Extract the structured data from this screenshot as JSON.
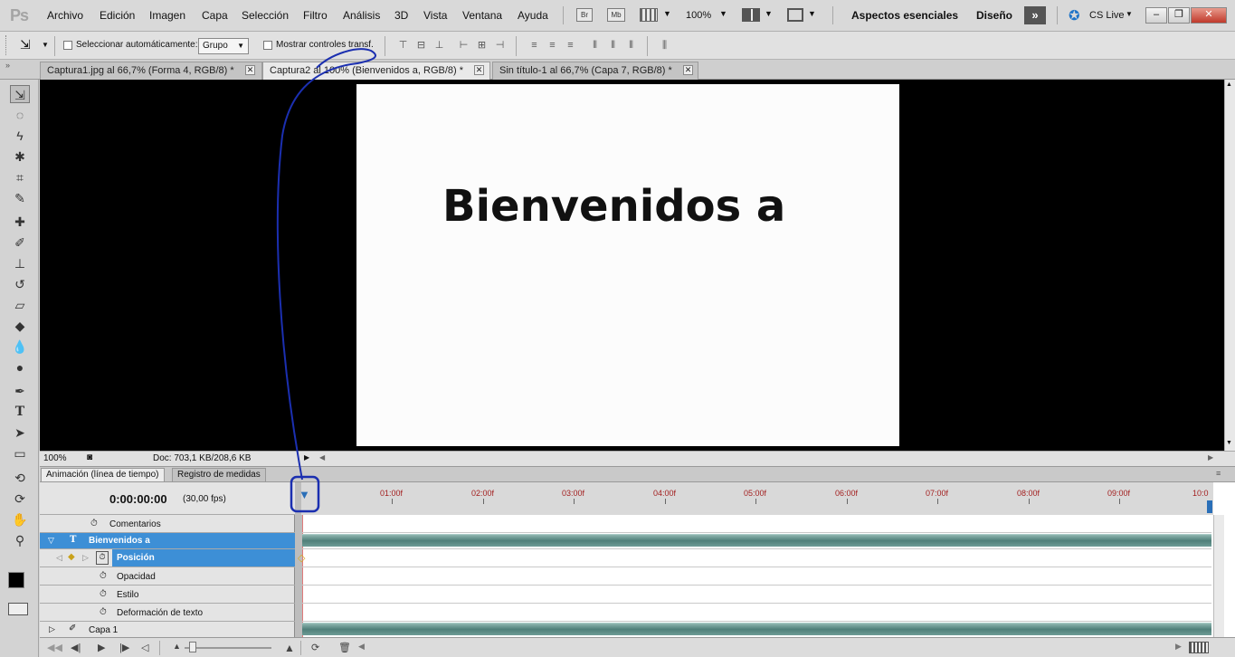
{
  "app": {
    "logo": "Ps"
  },
  "menu": [
    "Archivo",
    "Edición",
    "Imagen",
    "Capa",
    "Selección",
    "Filtro",
    "Análisis",
    "3D",
    "Vista",
    "Ventana",
    "Ayuda"
  ],
  "appbar": {
    "bridge": "Br",
    "minibridge": "Mb",
    "zoom": "100%",
    "workspace_essentials": "Aspectos esenciales",
    "workspace_design": "Diseño",
    "cslive": "CS Live"
  },
  "options": {
    "auto_select_label": "Seleccionar automáticamente:",
    "auto_select_value": "Grupo",
    "show_transform_label": "Mostrar controles transf."
  },
  "tabs": [
    {
      "label": "Captura1.jpg al 66,7% (Forma 4, RGB/8) *"
    },
    {
      "label": "Captura2 al 100% (Bienvenidos a, RGB/8) *"
    },
    {
      "label": "Sin título-1 al 66,7% (Capa 7, RGB/8) *"
    }
  ],
  "document": {
    "text": "Bienvenidos a"
  },
  "status": {
    "zoom": "100%",
    "doc": "Doc: 703,1 KB/208,6 KB"
  },
  "panel": {
    "tab_animation": "Animación (línea de tiempo)",
    "tab_measure": "Registro de medidas"
  },
  "timeline": {
    "timecode": "0:00:00:00",
    "fps": "(30,00 fps)",
    "ticks": [
      "01:00f",
      "02:00f",
      "03:00f",
      "04:00f",
      "05:00f",
      "06:00f",
      "07:00f",
      "08:00f",
      "09:00f",
      "10:0"
    ],
    "rows": {
      "comments": "Comentarios",
      "layer1": "Bienvenidos a",
      "position": "Posición",
      "opacity": "Opacidad",
      "style": "Estilo",
      "warp": "Deformación de texto",
      "layer2": "Capa 1"
    }
  }
}
